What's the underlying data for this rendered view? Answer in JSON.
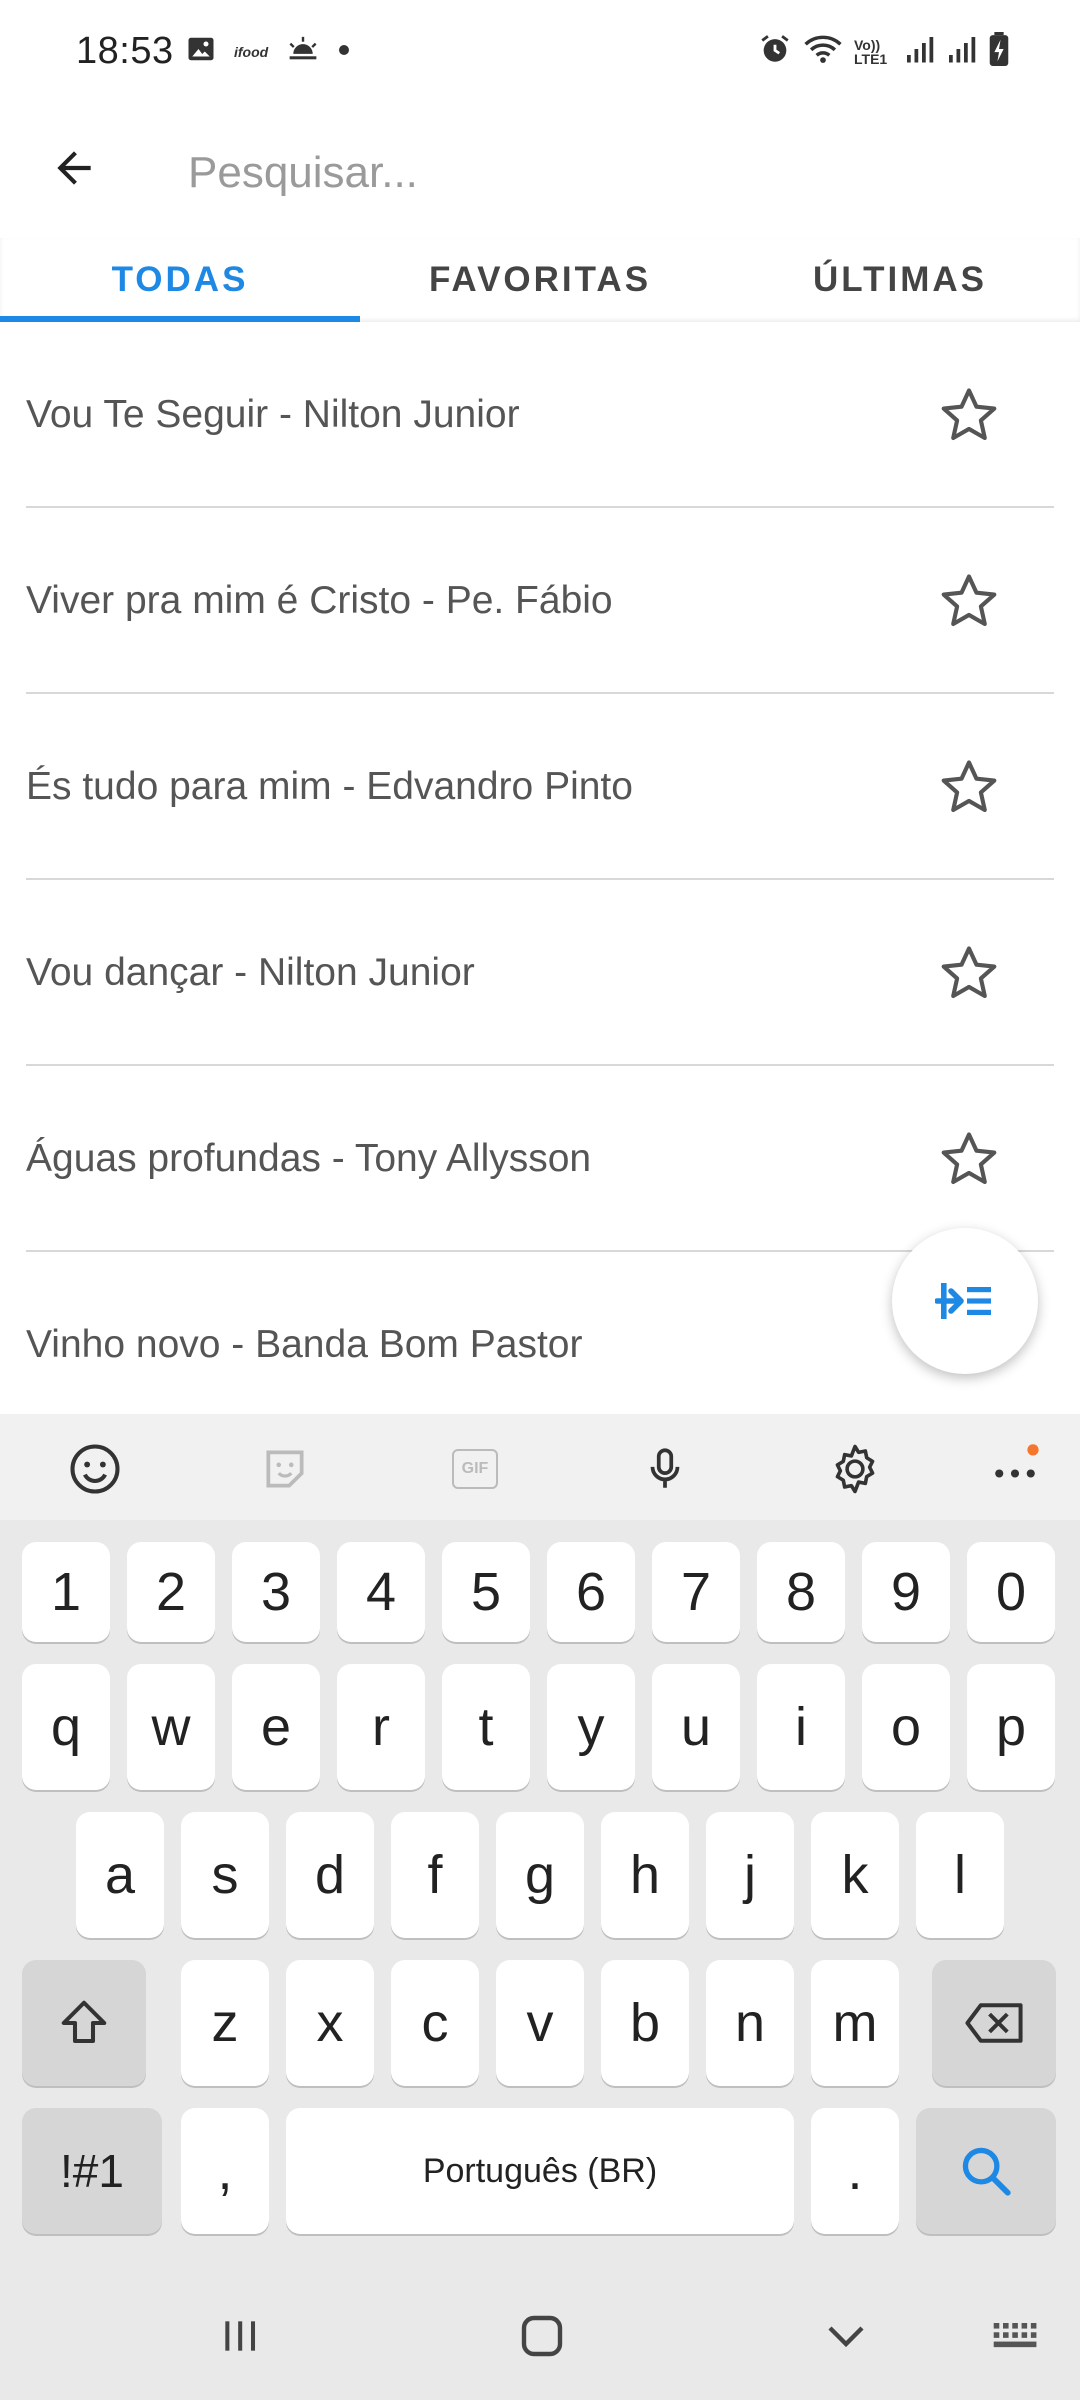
{
  "status_bar": {
    "time": "18:53",
    "left_icons": [
      "gallery-icon",
      "ifood-icon",
      "weather-icon",
      "dot-icon"
    ],
    "right_icons": [
      "alarm-icon",
      "wifi-icon",
      "volte-icon",
      "signal-icon",
      "signal-icon",
      "battery-icon"
    ],
    "volte_label": "Vo)) LTE1",
    "ifood_label": "ifood"
  },
  "app_bar": {
    "back_icon": "arrow-back-icon",
    "search_placeholder": "Pesquisar..."
  },
  "tabs": [
    {
      "label": "TODAS",
      "active": true
    },
    {
      "label": "FAVORITAS",
      "active": false
    },
    {
      "label": "ÚLTIMAS",
      "active": false
    }
  ],
  "songs": [
    {
      "title": "Vou Te Seguir - Nilton Junior",
      "favorite": false
    },
    {
      "title": "Viver pra mim é Cristo - Pe. Fábio",
      "favorite": false
    },
    {
      "title": "És tudo para mim - Edvandro Pinto",
      "favorite": false
    },
    {
      "title": "Vou dançar - Nilton Junior",
      "favorite": false
    },
    {
      "title": "Águas profundas - Tony Allysson",
      "favorite": false
    },
    {
      "title": "Vinho novo - Banda Bom Pastor",
      "favorite": false
    }
  ],
  "fab": {
    "icon": "indent-list-icon"
  },
  "keyboard": {
    "toolbar": [
      "emoji-icon",
      "sticker-icon",
      "gif-icon",
      "microphone-icon",
      "settings-icon",
      "more-icon"
    ],
    "gif_label": "GIF",
    "number_row": [
      "1",
      "2",
      "3",
      "4",
      "5",
      "6",
      "7",
      "8",
      "9",
      "0"
    ],
    "row1": [
      "q",
      "w",
      "e",
      "r",
      "t",
      "y",
      "u",
      "i",
      "o",
      "p"
    ],
    "row2": [
      "a",
      "s",
      "d",
      "f",
      "g",
      "h",
      "j",
      "k",
      "l"
    ],
    "row3": [
      "z",
      "x",
      "c",
      "v",
      "b",
      "n",
      "m"
    ],
    "symbols_label": "!#1",
    "comma_label": ",",
    "space_label": "Português (BR)",
    "period_label": "."
  },
  "colors": {
    "accent": "#1e88e5",
    "notification_dot": "#f4772d"
  }
}
